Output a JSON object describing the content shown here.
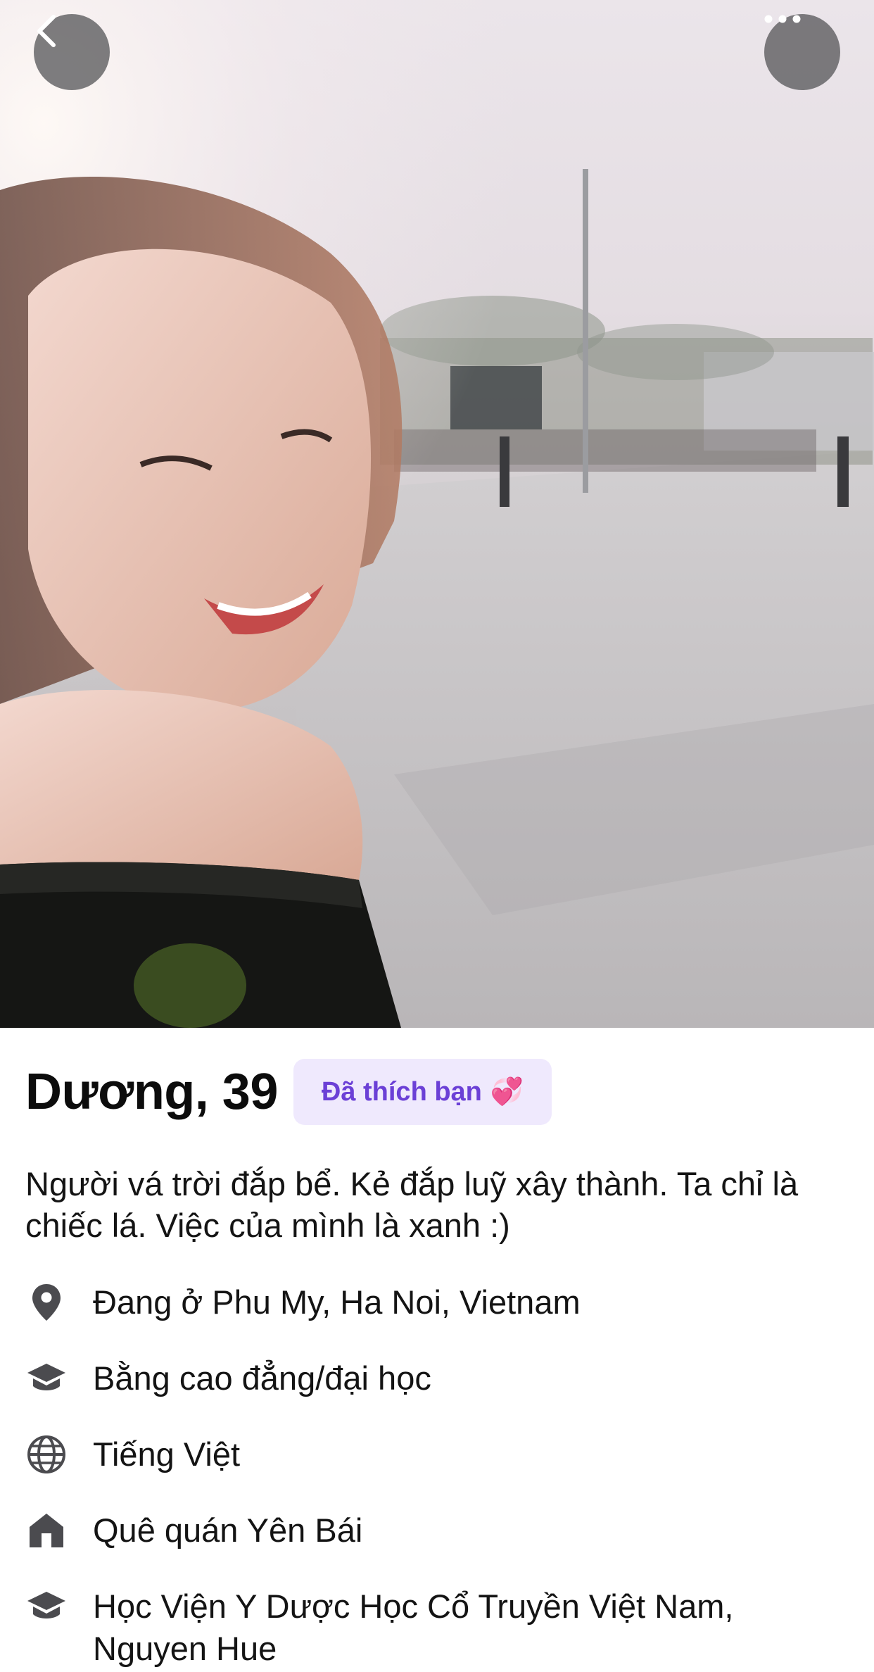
{
  "nav": {
    "back_icon": "chevron-left-icon",
    "more_icon": "ellipsis-horizontal-icon"
  },
  "profile": {
    "name_age": "Dương, 39",
    "liked_badge": "Đã thích bạn",
    "liked_badge_emoji": "💞",
    "bio": "Người vá trời đắp bể. Kẻ đắp luỹ xây thành. Ta chỉ là chiếc lá. Việc của mình là xanh :)"
  },
  "details": [
    {
      "icon": "location-pin-icon",
      "text": "Đang ở Phu My, Ha Noi, Vietnam"
    },
    {
      "icon": "graduation-cap-icon",
      "text": "Bằng cao đẳng/đại học"
    },
    {
      "icon": "globe-icon",
      "text": "Tiếng Việt"
    },
    {
      "icon": "home-icon",
      "text": "Quê quán Yên Bái"
    },
    {
      "icon": "graduation-cap-icon",
      "text": "Học Viện Y Dược Học Cổ Truyền Việt Nam, Nguyen Hue"
    }
  ],
  "colors": {
    "badge_background": "#efe9fd",
    "badge_text": "#6b40d6",
    "icon_gray": "#4b4b4f",
    "overlay_button": "#5a5a5c"
  }
}
